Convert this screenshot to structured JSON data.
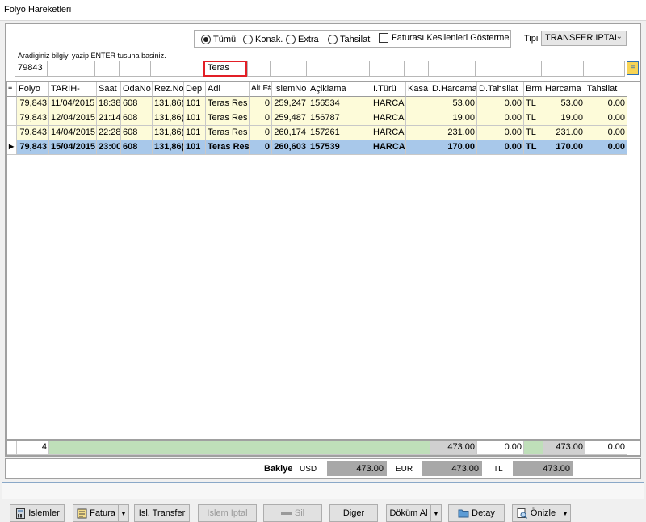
{
  "window": {
    "title": "Folyo Hareketleri"
  },
  "filters": {
    "radios": [
      {
        "label": "Tümü",
        "selected": true
      },
      {
        "label": "Konak.",
        "selected": false
      },
      {
        "label": "Extra",
        "selected": false
      },
      {
        "label": "Tahsilat",
        "selected": false
      }
    ],
    "checkbox_label": "Faturası Kesilenleri Gösterme",
    "checkbox_checked": false,
    "tipi_label": "Tipi",
    "tipi_value": "TRANSFER.IPTAL",
    "hint": "Aradiginiz bilgiyi yazip ENTER tusuna basiniz.",
    "search_values": [
      "79843",
      "",
      "",
      "",
      "",
      "",
      "Teras",
      "",
      "",
      "",
      "",
      "",
      "",
      "",
      "",
      "",
      ""
    ]
  },
  "grid": {
    "columns": [
      "Folyo",
      "TARIH-",
      "Saat",
      "OdaNo",
      "Rez.No",
      "Dep",
      "Adi",
      "Alt F#",
      "IslemNo",
      "Açiklama",
      "I.Türü",
      "Kasa",
      "D.Harcama",
      "D.Tahsilat",
      "Brm",
      "Harcama",
      "Tahsilat"
    ],
    "rows": [
      [
        "79,843",
        "11/04/2015",
        "18:38",
        "608",
        "131,86(",
        "101",
        "Teras Res",
        "0",
        "259,247",
        "156534",
        "HARCAM",
        "",
        "53.00",
        "0.00",
        "TL",
        "53.00",
        "0.00"
      ],
      [
        "79,843",
        "12/04/2015",
        "21:14",
        "608",
        "131,86(",
        "101",
        "Teras Res",
        "0",
        "259,487",
        "156787",
        "HARCAM",
        "",
        "19.00",
        "0.00",
        "TL",
        "19.00",
        "0.00"
      ],
      [
        "79,843",
        "14/04/2015",
        "22:28",
        "608",
        "131,86(",
        "101",
        "Teras Res",
        "0",
        "260,174",
        "157261",
        "HARCAM",
        "",
        "231.00",
        "0.00",
        "TL",
        "231.00",
        "0.00"
      ],
      [
        "79,843",
        "15/04/2015",
        "23:00",
        "608",
        "131,86(",
        "101",
        "Teras Res",
        "0",
        "260,603",
        "157539",
        "HARCAM",
        "",
        "170.00",
        "0.00",
        "TL",
        "170.00",
        "0.00"
      ]
    ],
    "selected_row": 3
  },
  "totals": {
    "count": "4",
    "d_harcama": "473.00",
    "d_tahsilat": "0.00",
    "harcama": "473.00",
    "tahsilat": "0.00"
  },
  "balance": {
    "label": "Bakiye",
    "usd_label": "USD",
    "usd_value": "473.00",
    "eur_label": "EUR",
    "eur_value": "473.00",
    "tl_label": "TL",
    "tl_value": "473.00"
  },
  "buttons": {
    "islemler": "Islemler",
    "fatura": "Fatura",
    "isl_transfer": "Isl. Transfer",
    "islem_iptal": "Islem Iptal",
    "sil": "Sil",
    "diger": "Diger",
    "dokum_al": "Döküm Al",
    "detay": "Detay",
    "onizle": "Önizle"
  },
  "colors": {
    "row_bg": "#fdfbd9",
    "selected_bg": "#a8c8ea",
    "totals_green": "#bfdfb9",
    "highlight_border": "#e21f26"
  }
}
